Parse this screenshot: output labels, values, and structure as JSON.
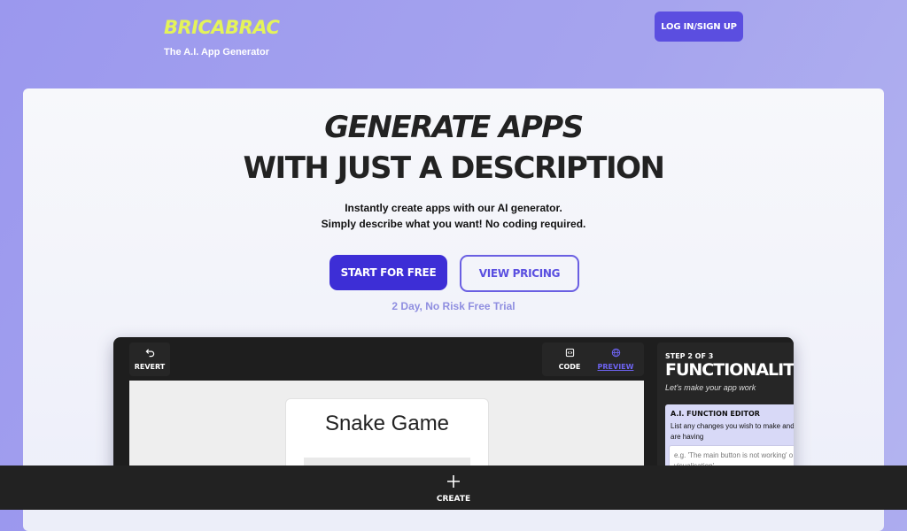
{
  "header": {
    "brand_name": "BRICABRAC",
    "tagline": "The A.I. App Generator",
    "login_label": "LOG IN/SIGN UP"
  },
  "hero": {
    "title_line1": "GENERATE APPS",
    "title_line2": "WITH JUST A DESCRIPTION",
    "subtitle_line1": "Instantly create apps with our AI generator.",
    "subtitle_line2": "Simply describe what you want! No coding required.",
    "primary_cta": "START FOR FREE",
    "secondary_cta": "VIEW PRICING",
    "trial_note": "2 Day, No Risk Free Trial"
  },
  "app_preview": {
    "revert_label": "REVERT",
    "code_label": "CODE",
    "preview_label": "PREVIEW",
    "game_title": "Snake Game",
    "step_label": "STEP 2 OF 3",
    "panel_title": "FUNCTIONALITY",
    "panel_subtitle": "Let's make your app work",
    "editor_title": "A.I. FUNCTION EDITOR",
    "editor_description": "List any changes you wish to make and i are having",
    "editor_placeholder": "e.g. 'The main button is not working' o visualisation'"
  },
  "bottom_bar": {
    "create_label": "CREATE"
  },
  "colors": {
    "brand_yellow": "#e4f35a",
    "primary": "#3d2ed6",
    "login": "#5b4ee0",
    "preview_link": "#6d63f0"
  }
}
